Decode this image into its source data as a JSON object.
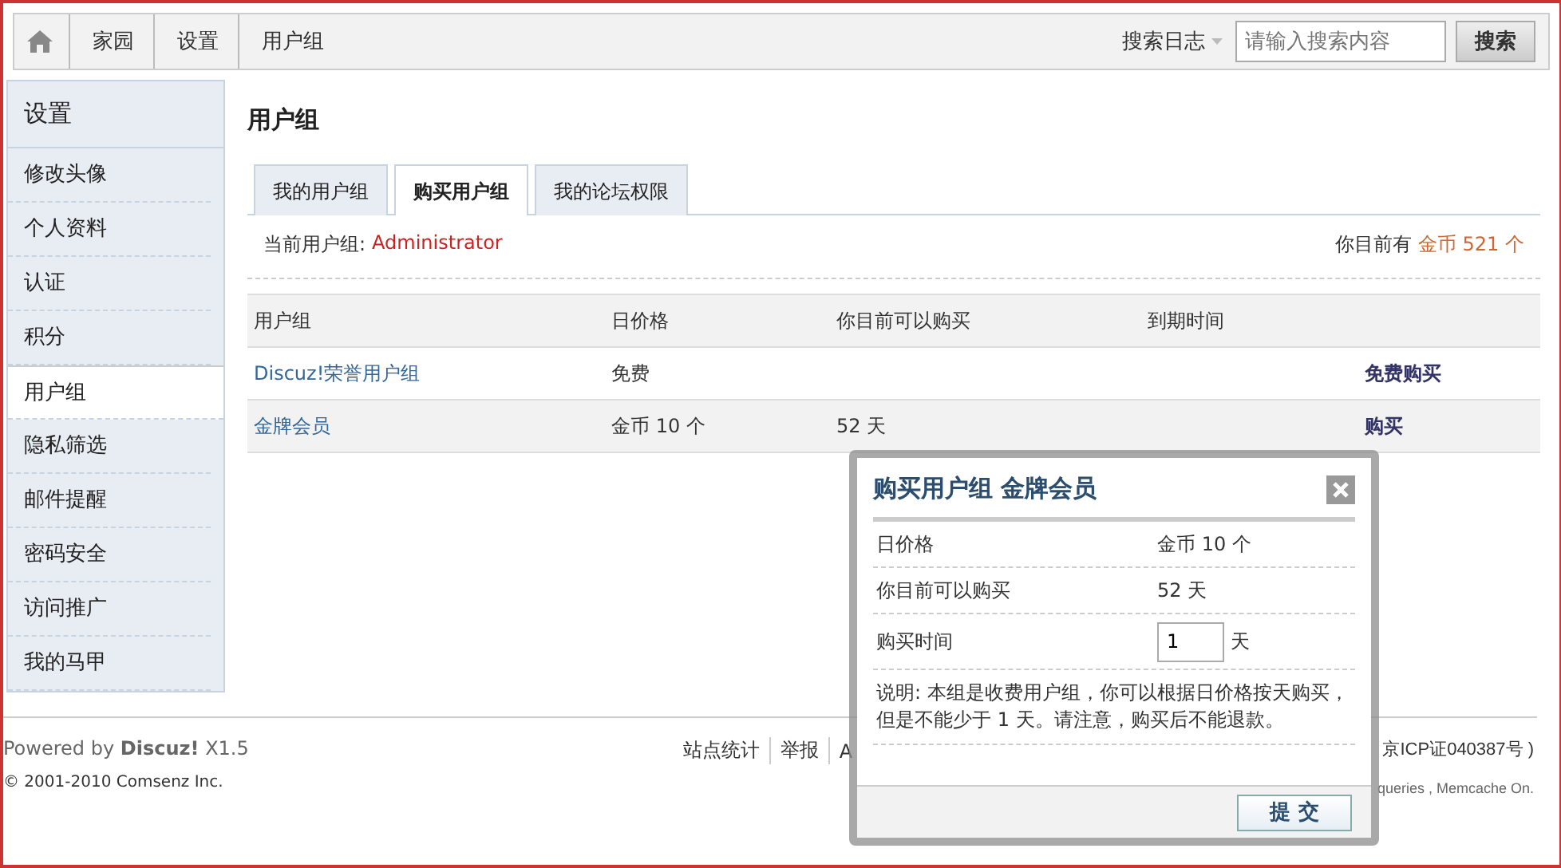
{
  "breadcrumb": [
    "家园",
    "设置",
    "用户组"
  ],
  "search": {
    "scope": "搜索日志",
    "placeholder": "请输入搜索内容",
    "button": "搜索"
  },
  "sidebar": {
    "title": "设置",
    "items": [
      {
        "label": "修改头像",
        "selected": false
      },
      {
        "label": "个人资料",
        "selected": false
      },
      {
        "label": "认证",
        "selected": false
      },
      {
        "label": "积分",
        "selected": false
      },
      {
        "label": "用户组",
        "selected": true
      },
      {
        "label": "隐私筛选",
        "selected": false
      },
      {
        "label": "邮件提醒",
        "selected": false
      },
      {
        "label": "密码安全",
        "selected": false
      },
      {
        "label": "访问推广",
        "selected": false
      },
      {
        "label": "我的马甲",
        "selected": false
      }
    ]
  },
  "heading": "用户组",
  "tabs": [
    {
      "label": "我的用户组",
      "selected": false
    },
    {
      "label": "购买用户组",
      "selected": true
    },
    {
      "label": "我的论坛权限",
      "selected": false
    }
  ],
  "current_group": {
    "label": "当前用户组:",
    "value": "Administrator"
  },
  "balance": {
    "label": "你目前有",
    "value": "金币 521 个"
  },
  "table": {
    "columns": [
      "用户组",
      "日价格",
      "你目前可以购买",
      "到期时间"
    ],
    "rows": [
      {
        "group": "Discuz!荣誉用户组",
        "price": "免费",
        "can_buy": "",
        "expiry": "",
        "action": "免费购买"
      },
      {
        "group": "金牌会员",
        "price": "金币 10 个",
        "can_buy": "52 天",
        "expiry": "",
        "action": "购买"
      }
    ]
  },
  "footer": {
    "powered": "Powered by",
    "brand": "Discuz!",
    "version": "X1.5",
    "copyright": "© 2001-2010 Comsenz Inc.",
    "links": [
      "站点统计",
      "举报",
      "A"
    ],
    "icp": "京ICP证040387号 )",
    "stats": "queries , Memcache On."
  },
  "dialog": {
    "title": "购买用户组 金牌会员",
    "rows": [
      {
        "kind": "text",
        "label": "日价格",
        "value": "金币 10 个"
      },
      {
        "kind": "text",
        "label": "你目前可以购买",
        "value": "52 天"
      },
      {
        "kind": "input",
        "label": "购买时间",
        "value": "1",
        "unit": "天"
      }
    ],
    "note": "说明: 本组是收费用户组，你可以根据日价格按天购买，但是不能少于 1 天。请注意，购买后不能退款。",
    "submit": "提 交"
  }
}
